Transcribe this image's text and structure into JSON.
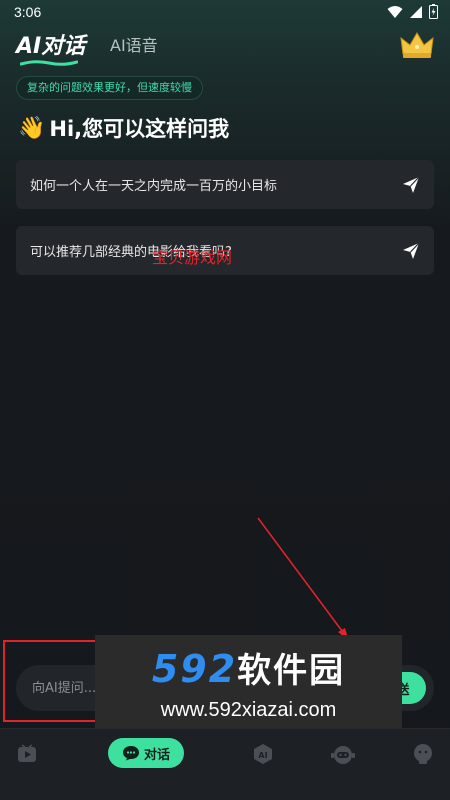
{
  "status_bar": {
    "time": "3:06"
  },
  "header": {
    "active_tab": "AI对话",
    "inactive_tab": "AI语音",
    "premium_icon": "crown-icon"
  },
  "hint": "复杂的问题效果更好，但速度较慢",
  "greeting": {
    "emoji": "👋",
    "text": "Hi,您可以这样问我"
  },
  "suggestions": [
    {
      "text": "如何一个人在一天之内完成一百万的小目标"
    },
    {
      "text": "可以推荐几部经典的电影给我看吗?"
    }
  ],
  "watermark": "宝贝游戏网",
  "input": {
    "placeholder": "向AI提问...",
    "send_label": "送"
  },
  "ad": {
    "title_num": "592",
    "title_cn": "软件园",
    "url": "www.592xiazai.com"
  },
  "bottom_nav": {
    "chat_label": "对话"
  },
  "colors": {
    "accent": "#3ee0a0",
    "background": "#15171b",
    "card": "#24272c",
    "annotation_red": "#e0242a"
  }
}
